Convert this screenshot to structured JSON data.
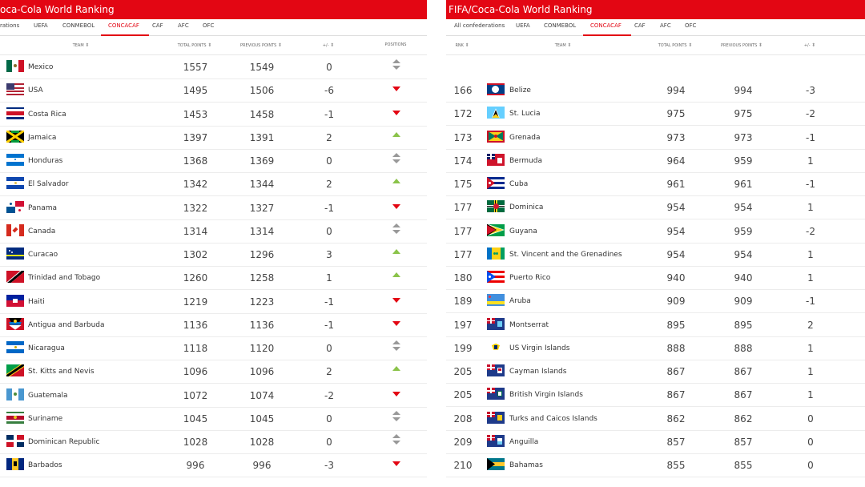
{
  "left": {
    "title": "oca-Cola World Ranking",
    "tabs": [
      "rations",
      "UEFA",
      "CONMEBOL",
      "CONCACAF",
      "CAF",
      "AFC",
      "OFC"
    ],
    "active_tab": "CONCACAF",
    "columns": [
      "TEAM",
      "TOTAL POINTS",
      "PREVIOUS POINTS",
      "+/-",
      "POSITIONS"
    ],
    "rows": [
      {
        "team": "Mexico",
        "total": "1557",
        "prev": "1549",
        "diff": "0",
        "trend": "same",
        "flag": "mexico"
      },
      {
        "team": "USA",
        "total": "1495",
        "prev": "1506",
        "diff": "-6",
        "trend": "down",
        "flag": "usa"
      },
      {
        "team": "Costa Rica",
        "total": "1453",
        "prev": "1458",
        "diff": "-1",
        "trend": "down",
        "flag": "costarica"
      },
      {
        "team": "Jamaica",
        "total": "1397",
        "prev": "1391",
        "diff": "2",
        "trend": "up",
        "flag": "jamaica"
      },
      {
        "team": "Honduras",
        "total": "1368",
        "prev": "1369",
        "diff": "0",
        "trend": "same",
        "flag": "honduras"
      },
      {
        "team": "El Salvador",
        "total": "1342",
        "prev": "1344",
        "diff": "2",
        "trend": "up",
        "flag": "elsalvador"
      },
      {
        "team": "Panama",
        "total": "1322",
        "prev": "1327",
        "diff": "-1",
        "trend": "down",
        "flag": "panama"
      },
      {
        "team": "Canada",
        "total": "1314",
        "prev": "1314",
        "diff": "0",
        "trend": "same",
        "flag": "canada"
      },
      {
        "team": "Curacao",
        "total": "1302",
        "prev": "1296",
        "diff": "3",
        "trend": "up",
        "flag": "curacao"
      },
      {
        "team": "Trinidad and Tobago",
        "total": "1260",
        "prev": "1258",
        "diff": "1",
        "trend": "up",
        "flag": "trinidad"
      },
      {
        "team": "Haiti",
        "total": "1219",
        "prev": "1223",
        "diff": "-1",
        "trend": "down",
        "flag": "haiti"
      },
      {
        "team": "Antigua and Barbuda",
        "total": "1136",
        "prev": "1136",
        "diff": "-1",
        "trend": "down",
        "flag": "antigua"
      },
      {
        "team": "Nicaragua",
        "total": "1118",
        "prev": "1120",
        "diff": "0",
        "trend": "same",
        "flag": "nicaragua"
      },
      {
        "team": "St. Kitts and Nevis",
        "total": "1096",
        "prev": "1096",
        "diff": "2",
        "trend": "up",
        "flag": "stkitts"
      },
      {
        "team": "Guatemala",
        "total": "1072",
        "prev": "1074",
        "diff": "-2",
        "trend": "down",
        "flag": "guatemala"
      },
      {
        "team": "Suriname",
        "total": "1045",
        "prev": "1045",
        "diff": "0",
        "trend": "same",
        "flag": "suriname"
      },
      {
        "team": "Dominican Republic",
        "total": "1028",
        "prev": "1028",
        "diff": "0",
        "trend": "same",
        "flag": "dominicanrep"
      },
      {
        "team": "Barbados",
        "total": "996",
        "prev": "996",
        "diff": "-3",
        "trend": "down",
        "flag": "barbados"
      }
    ]
  },
  "right": {
    "title": "FIFA/Coca-Cola World Ranking",
    "tabs": [
      "All confederations",
      "UEFA",
      "CONMEBOL",
      "CONCACAF",
      "CAF",
      "AFC",
      "OFC"
    ],
    "active_tab": "CONCACAF",
    "columns": [
      "RNK",
      "TEAM",
      "TOTAL POINTS",
      "PREVIOUS POINTS",
      "+/-"
    ],
    "rows": [
      {
        "rank": "166",
        "team": "Belize",
        "total": "994",
        "prev": "994",
        "diff": "-3",
        "flag": "belize"
      },
      {
        "rank": "172",
        "team": "St. Lucia",
        "total": "975",
        "prev": "975",
        "diff": "-2",
        "flag": "stlucia"
      },
      {
        "rank": "173",
        "team": "Grenada",
        "total": "973",
        "prev": "973",
        "diff": "-1",
        "flag": "grenada"
      },
      {
        "rank": "174",
        "team": "Bermuda",
        "total": "964",
        "prev": "959",
        "diff": "1",
        "flag": "bermuda"
      },
      {
        "rank": "175",
        "team": "Cuba",
        "total": "961",
        "prev": "961",
        "diff": "-1",
        "flag": "cuba"
      },
      {
        "rank": "177",
        "team": "Dominica",
        "total": "954",
        "prev": "954",
        "diff": "1",
        "flag": "dominica"
      },
      {
        "rank": "177",
        "team": "Guyana",
        "total": "954",
        "prev": "959",
        "diff": "-2",
        "flag": "guyana"
      },
      {
        "rank": "177",
        "team": "St. Vincent and the Grenadines",
        "total": "954",
        "prev": "954",
        "diff": "1",
        "flag": "stvincent"
      },
      {
        "rank": "180",
        "team": "Puerto Rico",
        "total": "940",
        "prev": "940",
        "diff": "1",
        "flag": "puertorico"
      },
      {
        "rank": "189",
        "team": "Aruba",
        "total": "909",
        "prev": "909",
        "diff": "-1",
        "flag": "aruba"
      },
      {
        "rank": "197",
        "team": "Montserrat",
        "total": "895",
        "prev": "895",
        "diff": "2",
        "flag": "montserrat"
      },
      {
        "rank": "199",
        "team": "US Virgin Islands",
        "total": "888",
        "prev": "888",
        "diff": "1",
        "flag": "usvi"
      },
      {
        "rank": "205",
        "team": "Cayman Islands",
        "total": "867",
        "prev": "867",
        "diff": "1",
        "flag": "cayman"
      },
      {
        "rank": "205",
        "team": "British Virgin Islands",
        "total": "867",
        "prev": "867",
        "diff": "1",
        "flag": "bvi"
      },
      {
        "rank": "208",
        "team": "Turks and Caicos Islands",
        "total": "862",
        "prev": "862",
        "diff": "0",
        "flag": "turks"
      },
      {
        "rank": "209",
        "team": "Anguilla",
        "total": "857",
        "prev": "857",
        "diff": "0",
        "flag": "anguilla"
      },
      {
        "rank": "210",
        "team": "Bahamas",
        "total": "855",
        "prev": "855",
        "diff": "0",
        "flag": "bahamas"
      }
    ]
  },
  "colors": {
    "brand_red": "#e30613",
    "up_green": "#8bc34a",
    "down_red": "#e30613",
    "neutral_gray": "#999999"
  }
}
